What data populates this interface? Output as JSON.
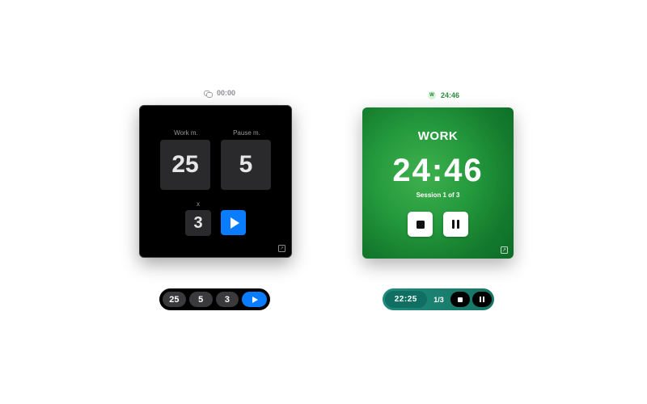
{
  "menubar_idle": {
    "icon": "chat-bubbles-icon",
    "time": "00:00"
  },
  "menubar_running": {
    "badge": "W",
    "time": "24:46"
  },
  "setup_panel": {
    "work_label": "Work m.",
    "pause_label": "Pause m.",
    "work_minutes": "25",
    "pause_minutes": "5",
    "repeat_label": "x",
    "repeat_count": "3",
    "play_icon": "play-icon",
    "expand_icon": "expand-icon"
  },
  "running_panel": {
    "mode_title": "WORK",
    "time": "24:46",
    "session_text": "Session 1 of 3",
    "stop_icon": "stop-icon",
    "pause_icon": "pause-icon",
    "expand_icon": "expand-icon"
  },
  "compact_setup": {
    "work": "25",
    "pause": "5",
    "repeat": "3",
    "play_icon": "play-icon"
  },
  "compact_running": {
    "time": "22:25",
    "progress": "1/3",
    "stop_icon": "stop-icon",
    "pause_icon": "pause-icon"
  },
  "colors": {
    "accent_blue": "#0A7CFF",
    "work_green": "#259A3D",
    "teal": "#1F8A7A",
    "menubar_green": "#2F8A3C"
  }
}
